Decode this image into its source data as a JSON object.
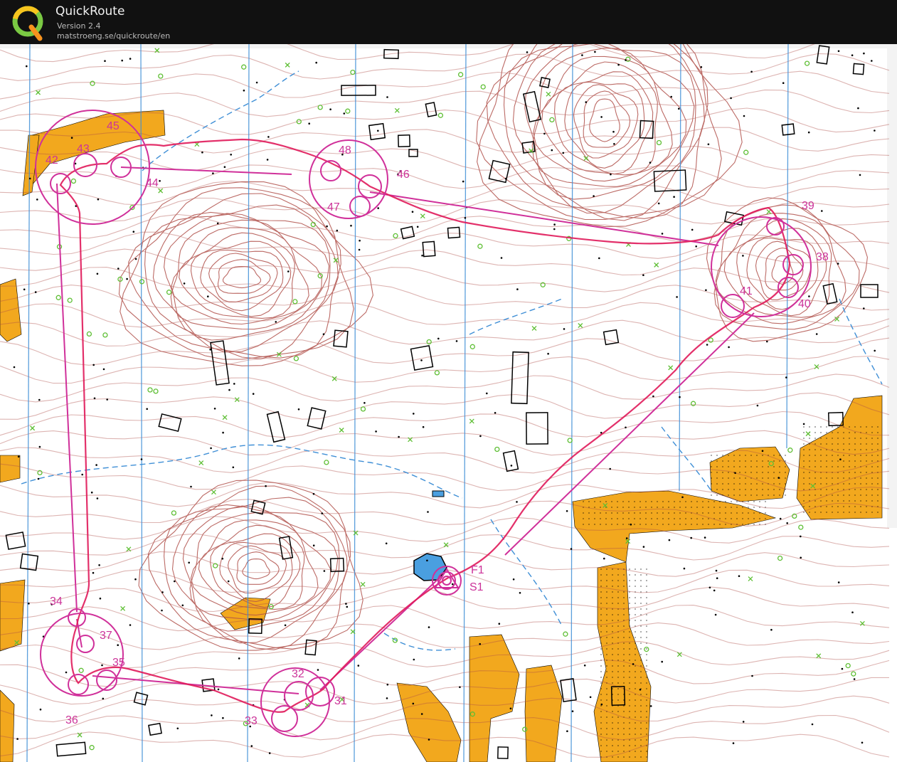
{
  "app": {
    "title": "QuickRoute",
    "version": "Version 2.4",
    "url": "matstroeng.se/quickroute/en",
    "logo_letter": "Q",
    "logo_icon": "quickroute-q-logo"
  },
  "map": {
    "controls": [
      {
        "id": "S1",
        "label": "S1"
      },
      {
        "id": "31",
        "label": "31"
      },
      {
        "id": "32",
        "label": "32"
      },
      {
        "id": "33",
        "label": "33"
      },
      {
        "id": "34",
        "label": "34"
      },
      {
        "id": "35",
        "label": "35"
      },
      {
        "id": "36",
        "label": "36"
      },
      {
        "id": "37",
        "label": "37"
      },
      {
        "id": "38",
        "label": "38"
      },
      {
        "id": "39",
        "label": "39"
      },
      {
        "id": "40",
        "label": "40"
      },
      {
        "id": "41",
        "label": "41"
      },
      {
        "id": "42",
        "label": "42"
      },
      {
        "id": "43",
        "label": "43"
      },
      {
        "id": "44",
        "label": "44"
      },
      {
        "id": "45",
        "label": "45"
      },
      {
        "id": "46",
        "label": "46"
      },
      {
        "id": "47",
        "label": "47"
      },
      {
        "id": "48",
        "label": "48"
      },
      {
        "id": "F1",
        "label": "F1"
      }
    ],
    "colors": {
      "contour": "#b0504a",
      "course": "#d0309a",
      "route": "#e01a5a",
      "water": "#4a90d9",
      "open_land": "#f2a81e",
      "vegetation": "#6dbf3a",
      "paper": "#ffffff"
    }
  }
}
